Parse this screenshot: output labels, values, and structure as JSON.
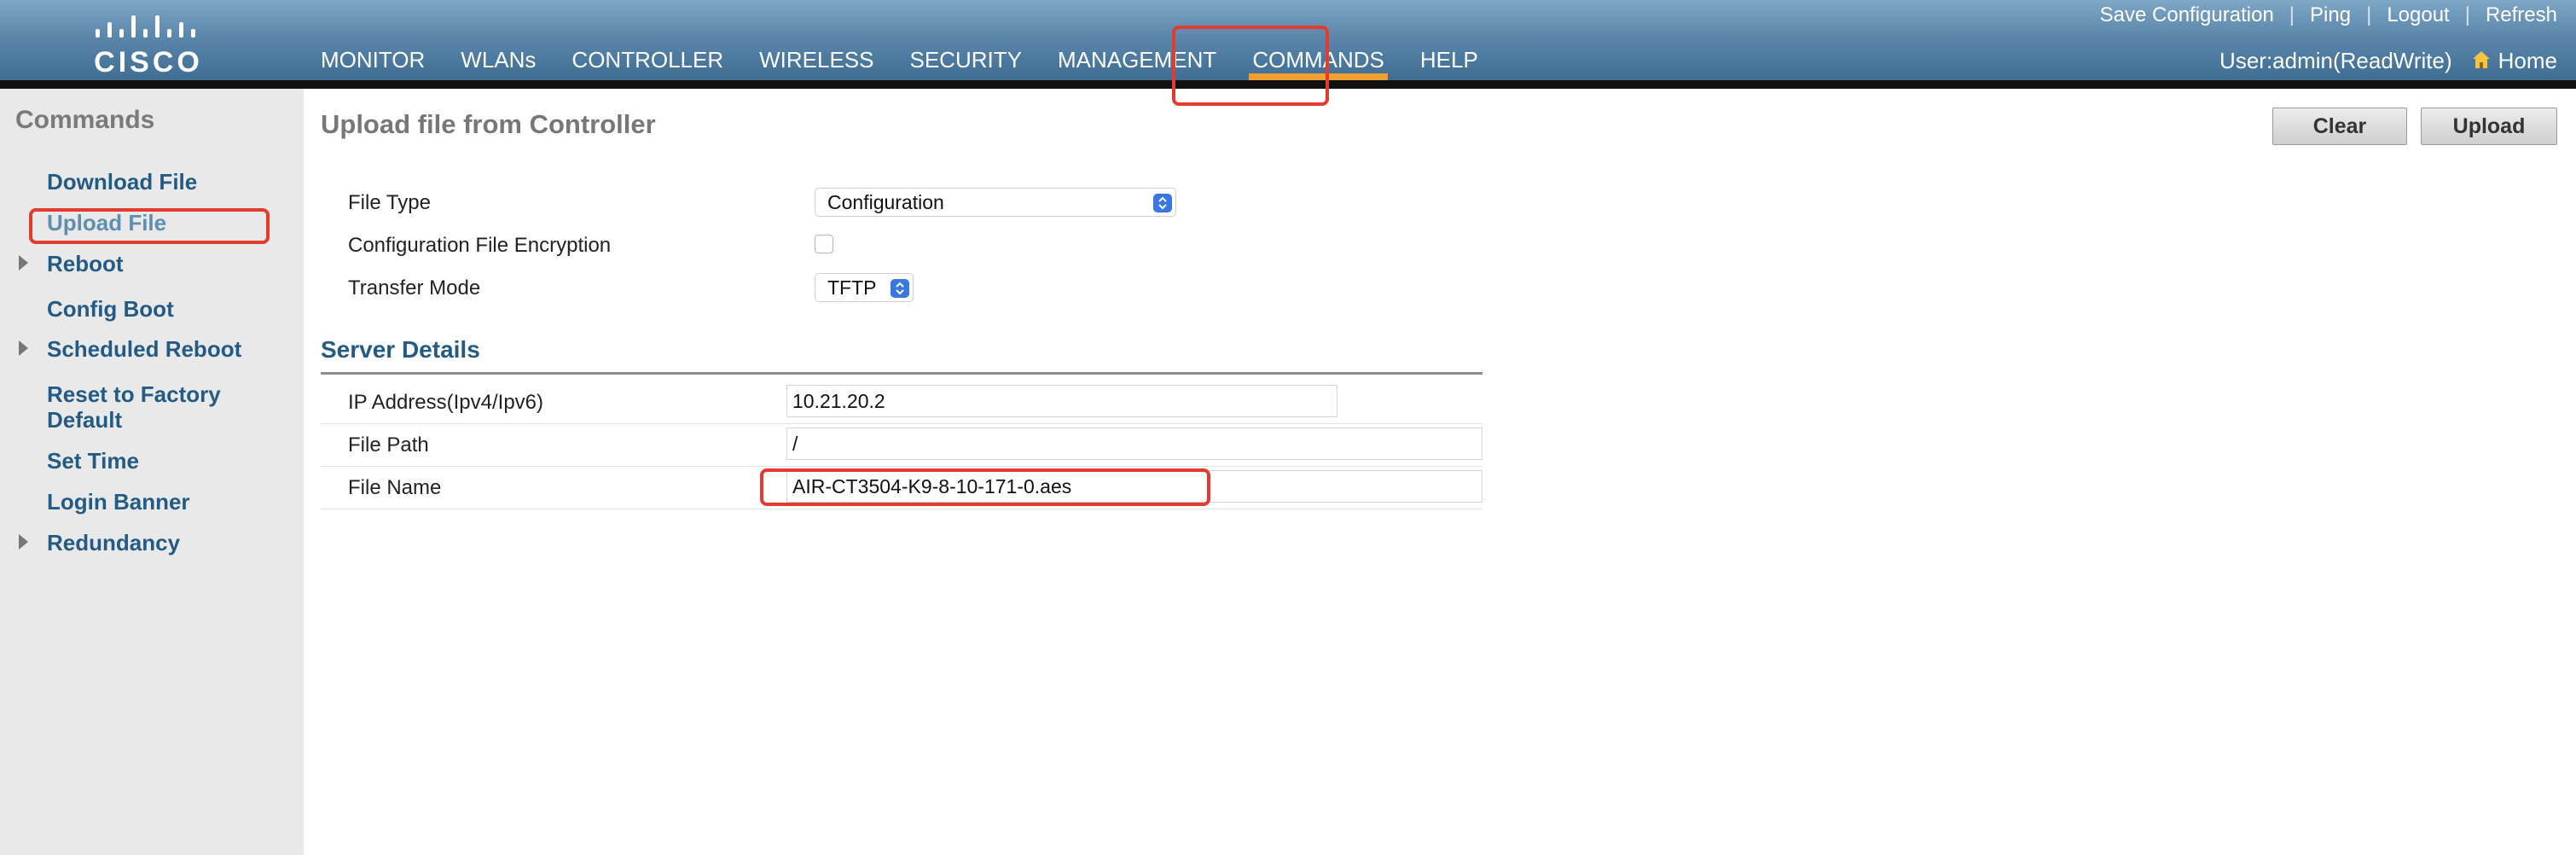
{
  "brand": {
    "logo_text": "CISCO"
  },
  "nav": {
    "items": [
      {
        "label": "MONITOR"
      },
      {
        "label": "WLANs"
      },
      {
        "label": "CONTROLLER"
      },
      {
        "label": "WIRELESS"
      },
      {
        "label": "SECURITY"
      },
      {
        "label": "MANAGEMENT"
      },
      {
        "label": "COMMANDS"
      },
      {
        "label": "HELP"
      }
    ],
    "active": "COMMANDS"
  },
  "toplinks": {
    "save": "Save Configuration",
    "ping": "Ping",
    "logout": "Logout",
    "refresh": "Refresh",
    "separator": "|"
  },
  "user": {
    "text": "User:admin(ReadWrite)",
    "home": "Home"
  },
  "sidebar": {
    "title": "Commands",
    "items": [
      {
        "label": "Download File"
      },
      {
        "label": "Upload File"
      },
      {
        "label": "Reboot"
      },
      {
        "label": "Config Boot"
      },
      {
        "label": "Scheduled Reboot"
      },
      {
        "label": "Reset to Factory Default"
      },
      {
        "label": "Set Time"
      },
      {
        "label": "Login Banner"
      },
      {
        "label": "Redundancy"
      }
    ]
  },
  "page": {
    "title": "Upload file from Controller",
    "clear_label": "Clear",
    "upload_label": "Upload"
  },
  "form": {
    "file_type_label": "File Type",
    "file_type_value": "Configuration",
    "encryption_label": "Configuration File Encryption",
    "transfer_mode_label": "Transfer Mode",
    "transfer_mode_value": "TFTP"
  },
  "server": {
    "title": "Server Details",
    "ip_label": "IP Address(Ipv4/Ipv6)",
    "ip_value": "10.21.20.2",
    "path_label": "File Path",
    "path_value": "/",
    "name_label": "File Name",
    "name_value": "AIR-CT3504-K9-8-10-171-0.aes"
  },
  "colors": {
    "header": "#5b87ab",
    "active_tab": "#f0a030",
    "link": "#245b84",
    "highlight": "#e33b2d"
  }
}
